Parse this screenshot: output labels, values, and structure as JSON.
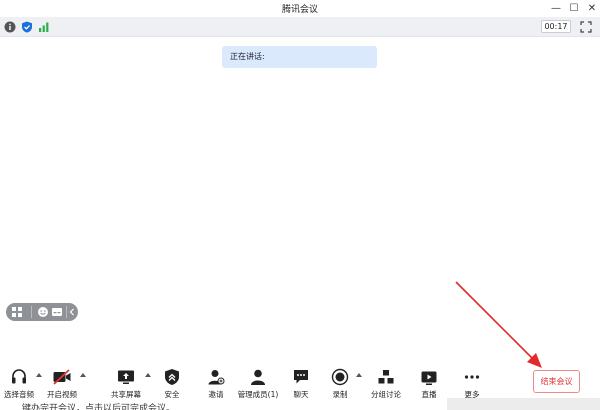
{
  "window": {
    "title": "腾讯会议",
    "minimize_symbol": "—",
    "maximize_symbol": "☐",
    "close_symbol": "✕"
  },
  "status": {
    "timer": "00:17",
    "icons": [
      "info-icon",
      "shield-icon",
      "signal-icon",
      "fullscreen-icon"
    ]
  },
  "meeting": {
    "speaking_label": "正在讲话:"
  },
  "reaction_pill": {
    "icons": [
      "layout-icon",
      "emoji-icon",
      "caption-icon",
      "collapse-icon"
    ]
  },
  "toolbar": {
    "audio": "选择音频",
    "video": "开启视频",
    "share": "共享屏幕",
    "security": "安全",
    "invite": "邀请",
    "members": "管理成员(1)",
    "chat": "聊天",
    "record": "录制",
    "breakout": "分组讨论",
    "live": "直播",
    "more": "更多",
    "end": "结束会议"
  },
  "doc": {
    "snippet": "键办完开会议，点击以后可完成会议。"
  },
  "colors": {
    "accent_red": "#e23434",
    "banner_bg": "#dbe9fc",
    "shield_blue": "#1a6fe0",
    "signal_green": "#2ab04a"
  }
}
